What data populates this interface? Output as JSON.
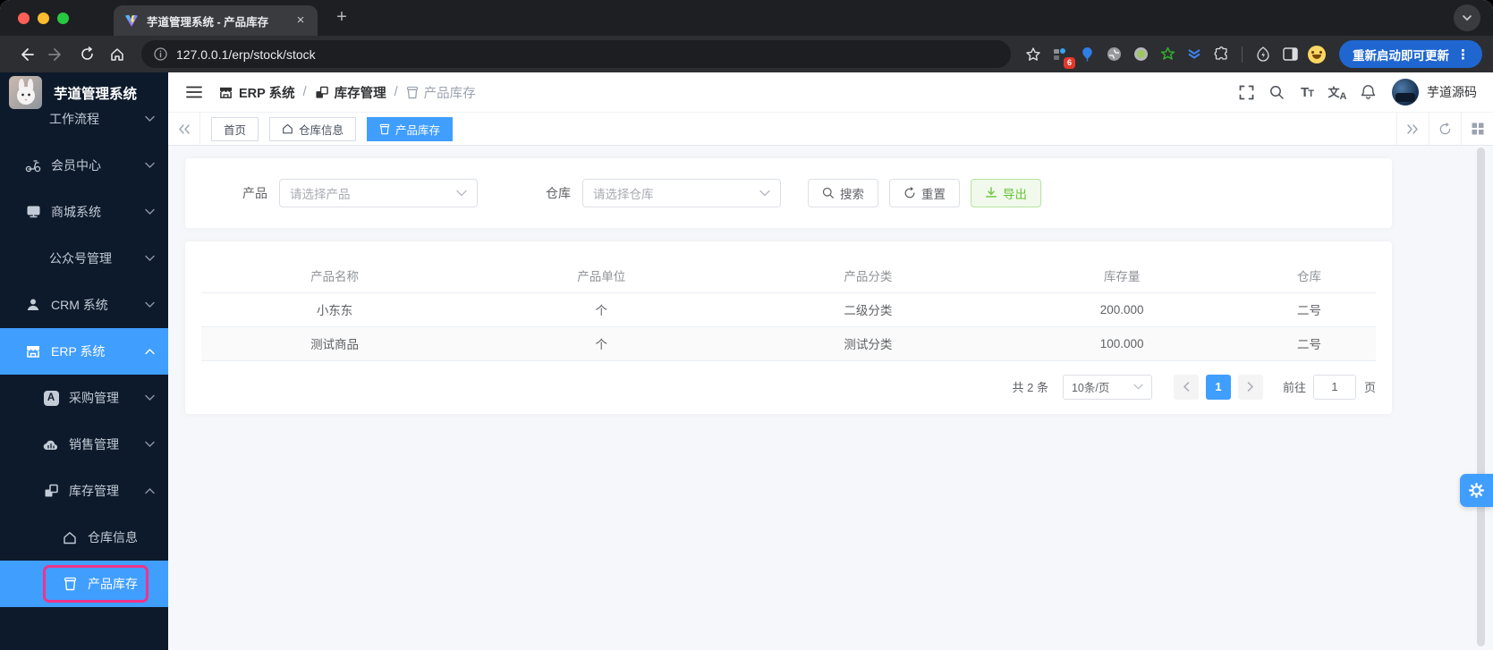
{
  "browser": {
    "tab_title": "芋道管理系统 - 产品库存",
    "url": "127.0.0.1/erp/stock/stock",
    "update_button_label": "重新启动即可更新",
    "extension_badge_count": "6"
  },
  "glyphs": {
    "close": "×",
    "plus": "+",
    "kebab": "⋮",
    "slash": "/",
    "font_large": "T",
    "font_small": "T",
    "translate_cjk": "文",
    "translate_latin": "A",
    "purchase_letter": "A"
  },
  "app": {
    "logo_title": "芋道管理系统",
    "username": "芋道源码"
  },
  "sidebar": {
    "items": [
      {
        "label": "工作流程"
      },
      {
        "label": "会员中心"
      },
      {
        "label": "商城系统"
      },
      {
        "label": "公众号管理"
      },
      {
        "label": "CRM 系统"
      },
      {
        "label": "ERP 系统"
      },
      {
        "label": "采购管理"
      },
      {
        "label": "销售管理"
      },
      {
        "label": "库存管理"
      },
      {
        "label": "仓库信息"
      },
      {
        "label": "产品库存"
      }
    ]
  },
  "breadcrumb": {
    "items": [
      {
        "label": "ERP 系统"
      },
      {
        "label": "库存管理"
      },
      {
        "label": "产品库存"
      }
    ]
  },
  "tabs": [
    {
      "label": "首页"
    },
    {
      "label": "仓库信息"
    },
    {
      "label": "产品库存"
    }
  ],
  "filters": {
    "product_label": "产品",
    "product_placeholder": "请选择产品",
    "warehouse_label": "仓库",
    "warehouse_placeholder": "请选择仓库",
    "search_label": "搜索",
    "reset_label": "重置",
    "export_label": "导出"
  },
  "table": {
    "columns": [
      "产品名称",
      "产品单位",
      "产品分类",
      "库存量",
      "仓库"
    ],
    "rows": [
      [
        "小东东",
        "个",
        "二级分类",
        "200.000",
        "二号"
      ],
      [
        "测试商品",
        "个",
        "测试分类",
        "100.000",
        "二号"
      ]
    ]
  },
  "pagination": {
    "total_text": "共 2 条",
    "page_size_value": "10条/页",
    "current_page": "1",
    "goto_label": "前往",
    "goto_value": "1",
    "page_unit": "页"
  },
  "colors": {
    "primary": "#409eff",
    "success": "#67c23a",
    "sidebar_bg": "#0d1a2b",
    "active_outline_pink": "#f0338a",
    "update_pill_blue": "#1f66d0"
  }
}
